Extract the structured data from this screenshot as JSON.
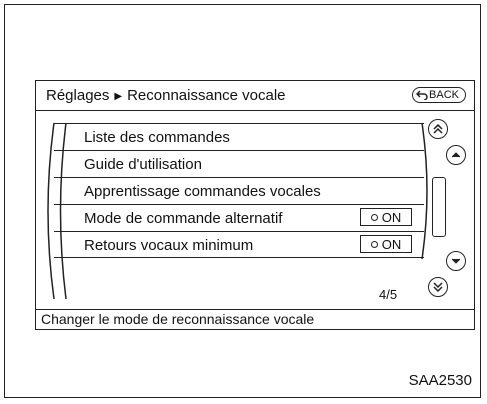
{
  "header": {
    "breadcrumb_parent": "Réglages",
    "breadcrumb_current": "Reconnaissance vocale",
    "back_label": "BACK"
  },
  "menu": {
    "items": [
      {
        "label": "Liste des commandes"
      },
      {
        "label": "Guide d'utilisation"
      },
      {
        "label": "Apprentissage commandes vocales"
      },
      {
        "label": "Mode de commande alternatif",
        "toggle": "ON"
      },
      {
        "label": "Retours vocaux minimum",
        "toggle": "ON"
      }
    ],
    "page_indicator": "4/5"
  },
  "status_bar": {
    "text": "Changer le mode de reconnaissance vocale"
  },
  "figure_code": "SAA2530",
  "icons": [
    "back-arrow-icon",
    "page-up-icon",
    "scroll-up-icon",
    "scroll-down-icon",
    "page-down-icon"
  ]
}
